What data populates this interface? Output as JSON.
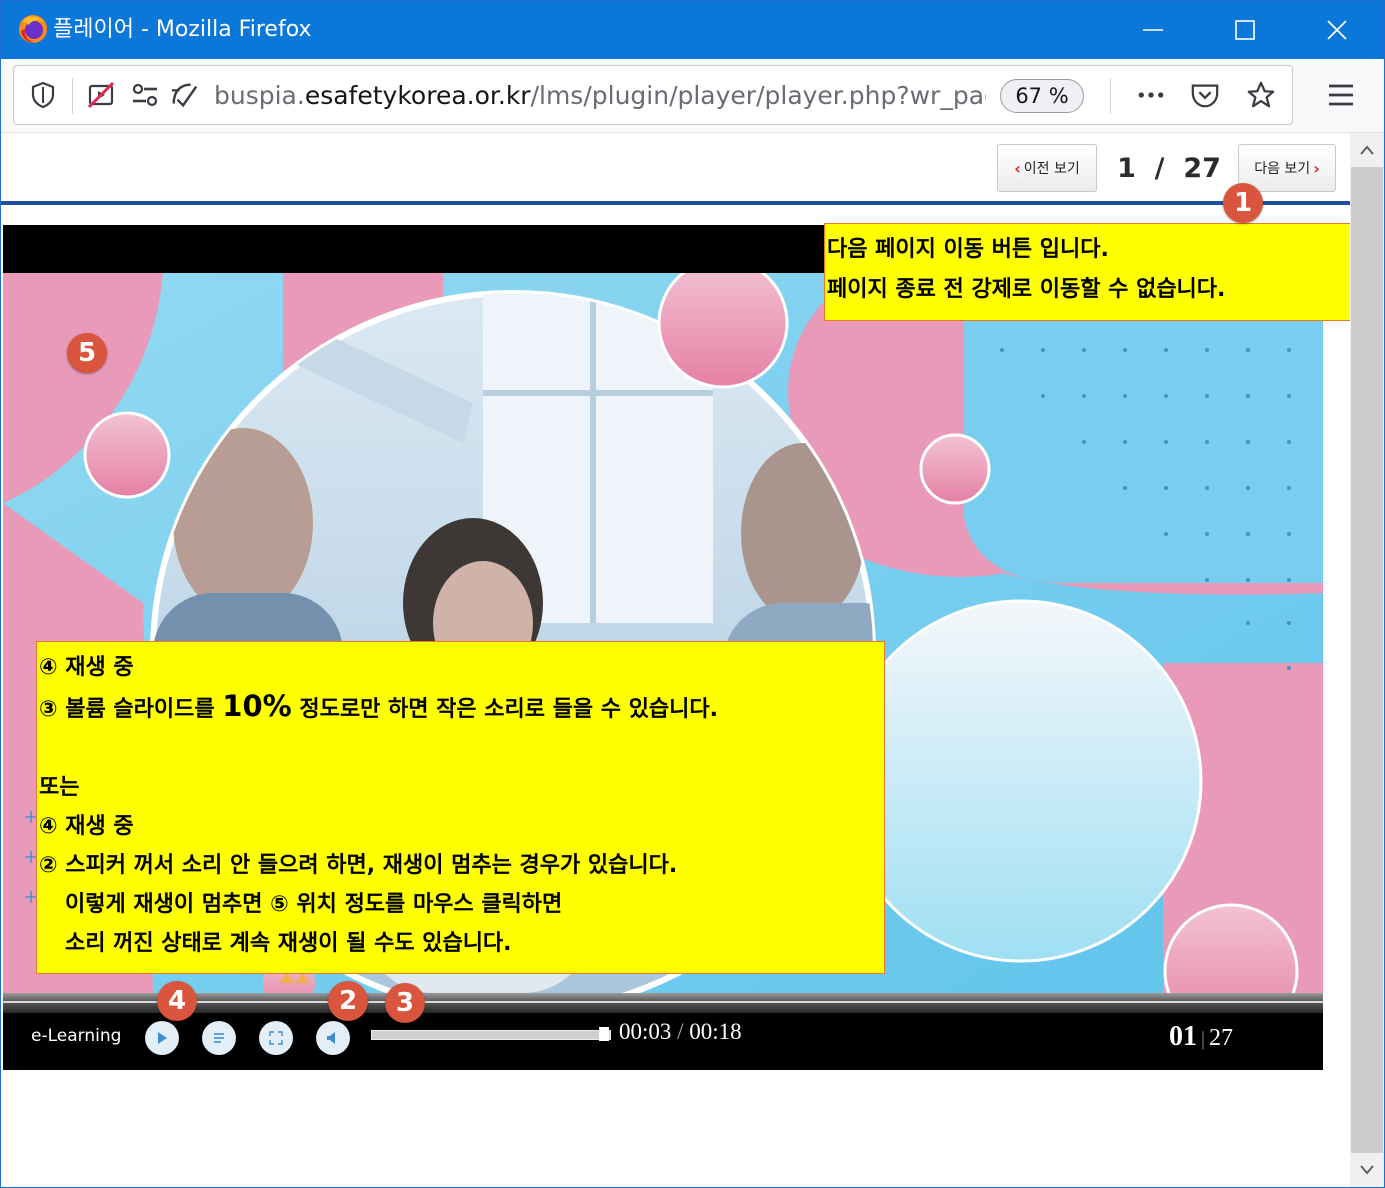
{
  "window": {
    "title": "플레이어 - Mozilla Firefox",
    "minimize_icon": "minimize-icon",
    "maximize_icon": "maximize-icon",
    "close_icon": "close-icon"
  },
  "toolbar": {
    "url_scheme_host_prefix": "buspia.",
    "url_host": "esafetykorea.or.kr",
    "url_path": "/lms/plugin/player/player.php?wr_pag",
    "zoom": "67 %",
    "icons": [
      "shield-icon",
      "autoplay-blocked-icon",
      "permissions-icon",
      "tracking-protection-icon",
      "more-icon",
      "pocket-icon",
      "bookmark-star-icon",
      "hamburger-menu-icon"
    ]
  },
  "pager": {
    "prev_label": "이전 보기",
    "next_label": "다음 보기",
    "current": "1",
    "separator": "/",
    "total": "27"
  },
  "player": {
    "brand": "e-Learning",
    "time_current": "00:03",
    "time_separator": "/",
    "time_total": "00:18",
    "slide_current": "01",
    "slide_separator": "|",
    "slide_total": "27",
    "volume_level_fraction": 0.98,
    "control_icons": [
      "play-icon",
      "menu-list-icon",
      "fullscreen-icon",
      "speaker-icon"
    ]
  },
  "annotations": {
    "badges": [
      "1",
      "2",
      "3",
      "4",
      "5"
    ],
    "note_top": {
      "line1": "다음 페이지 이동 버튼 입니다.",
      "line2": "페이지 종료 전 강제로 이동할 수 없습니다."
    },
    "note_bottom": {
      "line1": "④ 재생 중",
      "line2_pre": "③ 볼륨 슬라이드를 ",
      "line2_big": "10%",
      "line2_post": " 정도로만 하면 작은 소리로 들을 수 있습니다.",
      "line3": "또는",
      "line4": "④ 재생 중",
      "line5": "② 스피커 꺼서 소리 안 들으려 하면, 재생이 멈추는 경우가 있습니다.",
      "line6": "이렇게 재생이 멈추면 ⑤ 위치 정도를 마우스 클릭하면",
      "line7": "소리 꺼진 상태로 계속 재생이 될 수도 있습니다."
    }
  },
  "colors": {
    "titlebar": "#0b77d8",
    "note_bg": "#ffff00",
    "badge": "#d9553d",
    "rule": "#1f4fa0",
    "sky": "#85d2ee",
    "pink": "#e89ab8"
  }
}
